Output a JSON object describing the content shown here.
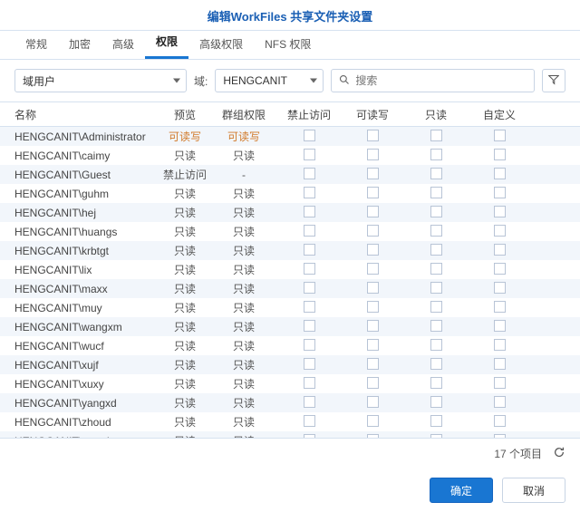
{
  "title": "编辑WorkFiles 共享文件夹设置",
  "tabs": [
    "常规",
    "加密",
    "高级",
    "权限",
    "高级权限",
    "NFS 权限"
  ],
  "active_tab": 3,
  "scope_select": "域用户",
  "domain_label": "域:",
  "domain_select": "HENGCANIT",
  "search_placeholder": "搜索",
  "columns": {
    "name": "名称",
    "preview": "预览",
    "group": "群组权限",
    "deny": "禁止访问",
    "rw": "可读写",
    "ro": "只读",
    "custom": "自定义"
  },
  "rows": [
    {
      "name": "HENGCANIT\\Administrator",
      "preview": "可读写",
      "group": "可读写",
      "pv": "rw"
    },
    {
      "name": "HENGCANIT\\caimy",
      "preview": "只读",
      "group": "只读",
      "pv": "ro"
    },
    {
      "name": "HENGCANIT\\Guest",
      "preview": "禁止访问",
      "group": "-",
      "pv": "deny"
    },
    {
      "name": "HENGCANIT\\guhm",
      "preview": "只读",
      "group": "只读",
      "pv": "ro"
    },
    {
      "name": "HENGCANIT\\hej",
      "preview": "只读",
      "group": "只读",
      "pv": "ro"
    },
    {
      "name": "HENGCANIT\\huangs",
      "preview": "只读",
      "group": "只读",
      "pv": "ro"
    },
    {
      "name": "HENGCANIT\\krbtgt",
      "preview": "只读",
      "group": "只读",
      "pv": "ro"
    },
    {
      "name": "HENGCANIT\\lix",
      "preview": "只读",
      "group": "只读",
      "pv": "ro"
    },
    {
      "name": "HENGCANIT\\maxx",
      "preview": "只读",
      "group": "只读",
      "pv": "ro"
    },
    {
      "name": "HENGCANIT\\muy",
      "preview": "只读",
      "group": "只读",
      "pv": "ro"
    },
    {
      "name": "HENGCANIT\\wangxm",
      "preview": "只读",
      "group": "只读",
      "pv": "ro"
    },
    {
      "name": "HENGCANIT\\wucf",
      "preview": "只读",
      "group": "只读",
      "pv": "ro"
    },
    {
      "name": "HENGCANIT\\xujf",
      "preview": "只读",
      "group": "只读",
      "pv": "ro"
    },
    {
      "name": "HENGCANIT\\xuxy",
      "preview": "只读",
      "group": "只读",
      "pv": "ro"
    },
    {
      "name": "HENGCANIT\\yangxd",
      "preview": "只读",
      "group": "只读",
      "pv": "ro"
    },
    {
      "name": "HENGCANIT\\zhoud",
      "preview": "只读",
      "group": "只读",
      "pv": "ro"
    },
    {
      "name": "HENGCANIT\\zouwj",
      "preview": "只读",
      "group": "只读",
      "pv": "ro"
    }
  ],
  "count_label": "17 个项目",
  "buttons": {
    "ok": "确定",
    "cancel": "取消"
  }
}
